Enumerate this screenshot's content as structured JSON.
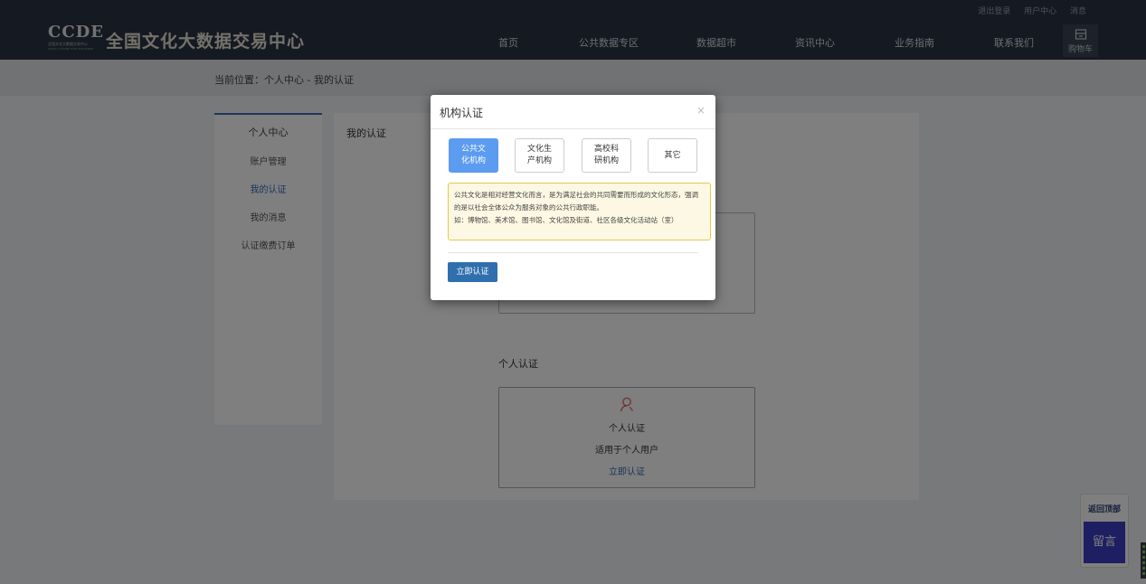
{
  "header": {
    "logo_text": "CCDE",
    "logo_sub_cn": "全国文化大数据交易中心",
    "logo_sub_en": "CHINA CULTURE DATA EXCHANGE",
    "site_name": "全国文化大数据交易中心",
    "top_links": [
      "退出登录",
      "用户中心",
      "消息"
    ],
    "nav": [
      "首页",
      "公共数据专区",
      "数据超市",
      "资讯中心",
      "业务指南",
      "联系我们"
    ],
    "cart_label": "购物车"
  },
  "breadcrumb": "当前位置：个人中心 - 我的认证",
  "sidebar": {
    "title": "个人中心",
    "items": [
      {
        "label": "账户管理"
      },
      {
        "label": "我的认证"
      },
      {
        "label": "我的消息"
      },
      {
        "label": "认证缴费订单"
      }
    ]
  },
  "main": {
    "title": "我的认证",
    "personal_section": "个人认证",
    "personal_card": {
      "title": "个人认证",
      "desc": "适用于个人用户",
      "action": "立即认证"
    }
  },
  "float": {
    "back_top": "返回顶部",
    "message": "留言"
  },
  "modal": {
    "title": "机构认证",
    "close": "×",
    "options": [
      {
        "label": "公共文化机构",
        "active": true
      },
      {
        "label": "文化生产机构",
        "active": false
      },
      {
        "label": "高校科研机构",
        "active": false
      },
      {
        "label": "其它",
        "active": false
      }
    ],
    "desc_line1": "公共文化是相对经营文化而言，是为满足社会的共同需要而形成的文化形态，强调的是以社会全体公众为服务对象的公共行政职能。",
    "desc_line2": "如：博物馆、美术馆、图书馆、文化馆及街道、社区各级文化活动站（室）",
    "submit": "立即认证"
  },
  "colors": {
    "topbar": "#2b3342",
    "accent": "#2f6fae",
    "active_option": "#5b9bf0",
    "notice_bg": "#fcf8e3",
    "notice_border": "#e5c94c",
    "message_button": "#3a3fc4"
  }
}
